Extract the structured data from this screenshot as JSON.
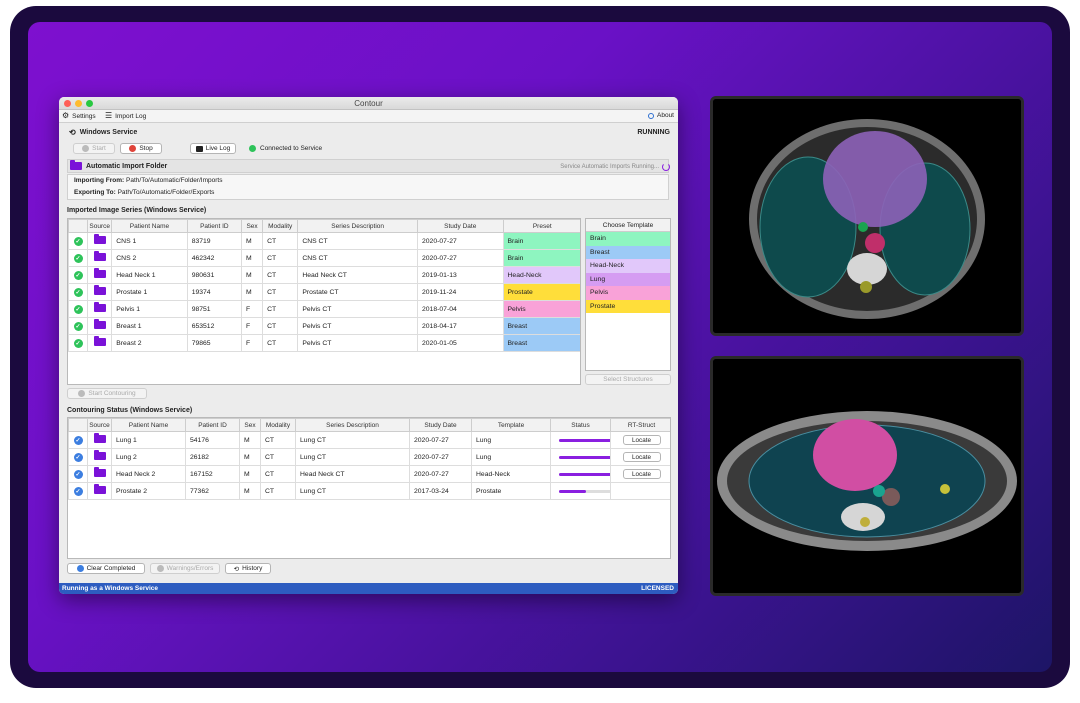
{
  "window": {
    "title": "Contour"
  },
  "menu": {
    "settings": "Settings",
    "import_log": "Import Log",
    "about": "About"
  },
  "windows_service": {
    "title": "Windows Service",
    "state": "RUNNING",
    "start_label": "Start",
    "stop_label": "Stop",
    "live_log_label": "Live Log",
    "connection_status": "Connected to Service"
  },
  "auto_import": {
    "title": "Automatic Import Folder",
    "status": "Service Automatic Imports Running...",
    "importing_from_label": "Importing From:",
    "importing_from": "Path/To/Automatic/Folder/Imports",
    "exporting_to_label": "Exporting To:",
    "exporting_to": "Path/To/Automatic/Folder/Exports"
  },
  "imported": {
    "title": "Imported Image Series (Windows Service)",
    "columns": [
      "Source",
      "Patient Name",
      "Patient ID",
      "Sex",
      "Modality",
      "Series Description",
      "Study Date",
      "Preset"
    ],
    "rows": [
      {
        "name": "CNS 1",
        "id": "83719",
        "sex": "M",
        "modality": "CT",
        "desc": "CNS CT",
        "date": "2020-07-27",
        "preset": "Brain",
        "color": "#8ef5c0"
      },
      {
        "name": "CNS 2",
        "id": "462342",
        "sex": "M",
        "modality": "CT",
        "desc": "CNS CT",
        "date": "2020-07-27",
        "preset": "Brain",
        "color": "#8ef5c0"
      },
      {
        "name": "Head Neck 1",
        "id": "980631",
        "sex": "M",
        "modality": "CT",
        "desc": "Head Neck CT",
        "date": "2019-01-13",
        "preset": "Head-Neck",
        "color": "#e1c8fa"
      },
      {
        "name": "Prostate 1",
        "id": "19374",
        "sex": "M",
        "modality": "CT",
        "desc": "Prostate CT",
        "date": "2019-11-24",
        "preset": "Prostate",
        "color": "#ffde3a"
      },
      {
        "name": "Pelvis 1",
        "id": "98751",
        "sex": "F",
        "modality": "CT",
        "desc": "Pelvis CT",
        "date": "2018-07-04",
        "preset": "Pelvis",
        "color": "#f9a2d8"
      },
      {
        "name": "Breast 1",
        "id": "653512",
        "sex": "F",
        "modality": "CT",
        "desc": "Pelvis CT",
        "date": "2018-04-17",
        "preset": "Breast",
        "color": "#9ccaf6"
      },
      {
        "name": "Breast 2",
        "id": "79865",
        "sex": "F",
        "modality": "CT",
        "desc": "Pelvis CT",
        "date": "2020-01-05",
        "preset": "Breast",
        "color": "#9ccaf6"
      }
    ],
    "start_contouring": "Start Contouring"
  },
  "templates": {
    "title": "Choose Template",
    "items": [
      {
        "label": "Brain",
        "color": "#8ef5c0"
      },
      {
        "label": "Breast",
        "color": "#9ccaf6"
      },
      {
        "label": "Head-Neck",
        "color": "#e1c8fa"
      },
      {
        "label": "Lung",
        "color": "#d59cf2"
      },
      {
        "label": "Pelvis",
        "color": "#f9a2d8"
      },
      {
        "label": "Prostate",
        "color": "#ffde3a"
      }
    ],
    "select_structures": "Select Structures"
  },
  "contouring": {
    "title": "Contouring Status (Windows Service)",
    "columns": [
      "Source",
      "Patient Name",
      "Patient ID",
      "Sex",
      "Modality",
      "Series Description",
      "Study Date",
      "Template",
      "Status",
      "RT-Struct"
    ],
    "rows": [
      {
        "name": "Lung 1",
        "id": "54176",
        "sex": "M",
        "modality": "CT",
        "desc": "Lung CT",
        "date": "2020-07-27",
        "template": "Lung",
        "progress": 1.0,
        "locate": "Locate"
      },
      {
        "name": "Lung 2",
        "id": "26182",
        "sex": "M",
        "modality": "CT",
        "desc": "Lung CT",
        "date": "2020-07-27",
        "template": "Lung",
        "progress": 1.0,
        "locate": "Locate"
      },
      {
        "name": "Head Neck 2",
        "id": "167152",
        "sex": "M",
        "modality": "CT",
        "desc": "Head Neck CT",
        "date": "2020-07-27",
        "template": "Head-Neck",
        "progress": 1.0,
        "locate": "Locate"
      },
      {
        "name": "Prostate 2",
        "id": "77362",
        "sex": "M",
        "modality": "CT",
        "desc": "Lung CT",
        "date": "2017-03-24",
        "template": "Prostate",
        "progress": 0.5,
        "locate": ""
      }
    ],
    "clear_completed": "Clear Completed",
    "warnings_errors": "Warnings/Errors",
    "history": "History"
  },
  "status_bar": {
    "left": "Running as a Windows Service",
    "right": "LICENSED"
  },
  "colors": {
    "accent": "#7a12d8",
    "ok_green": "#2ec35a",
    "ok_blue": "#3c7ee0",
    "stop_red": "#e0443a",
    "statusbar": "#2d5cc0"
  }
}
